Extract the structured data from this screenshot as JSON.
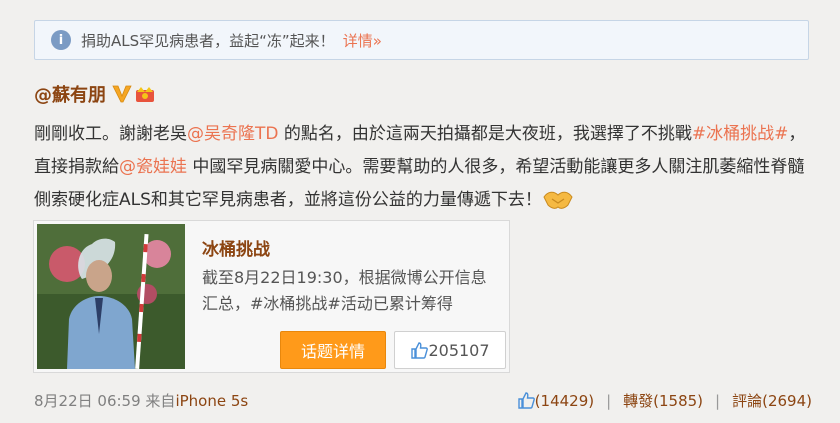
{
  "notice": {
    "icon": "info-icon",
    "text": "捐助ALS罕见病患者，益起“冻”起来！",
    "link": "详情»"
  },
  "post": {
    "username": "@蘇有朋",
    "text_1": "剛剛收工。謝謝老吳",
    "mention_1": "@吴奇隆TD",
    "text_2": " 的點名，由於這兩天拍攝都是大夜班，我選擇了不挑戰",
    "hashtag": "#冰桶挑战#",
    "text_3": "，直接捐款給",
    "mention_2": "@瓷娃娃",
    "text_4": " 中國罕見病關愛中心。需要幫助的人很多，希望活動能讓更多人關注肌萎縮性脊髓側索硬化症ALS和其它罕見病患者，並將這份公益的力量傳遞下去！"
  },
  "card": {
    "title": "冰桶挑战",
    "description": "截至8月22日19:30，根据微博公开信息汇总，#冰桶挑战#活动已累计筹得",
    "topic_button": "话题详情",
    "like_count": "205107"
  },
  "footer": {
    "timestamp": "8月22日 06:59",
    "source_prefix": "来自",
    "source": "iPhone 5s",
    "likes": "(14429)",
    "repost": "轉發(1585)",
    "comments": "評論(2694)"
  },
  "colors": {
    "link": "#eb7350",
    "username": "#8c4512",
    "button": "#ff9a1a"
  }
}
